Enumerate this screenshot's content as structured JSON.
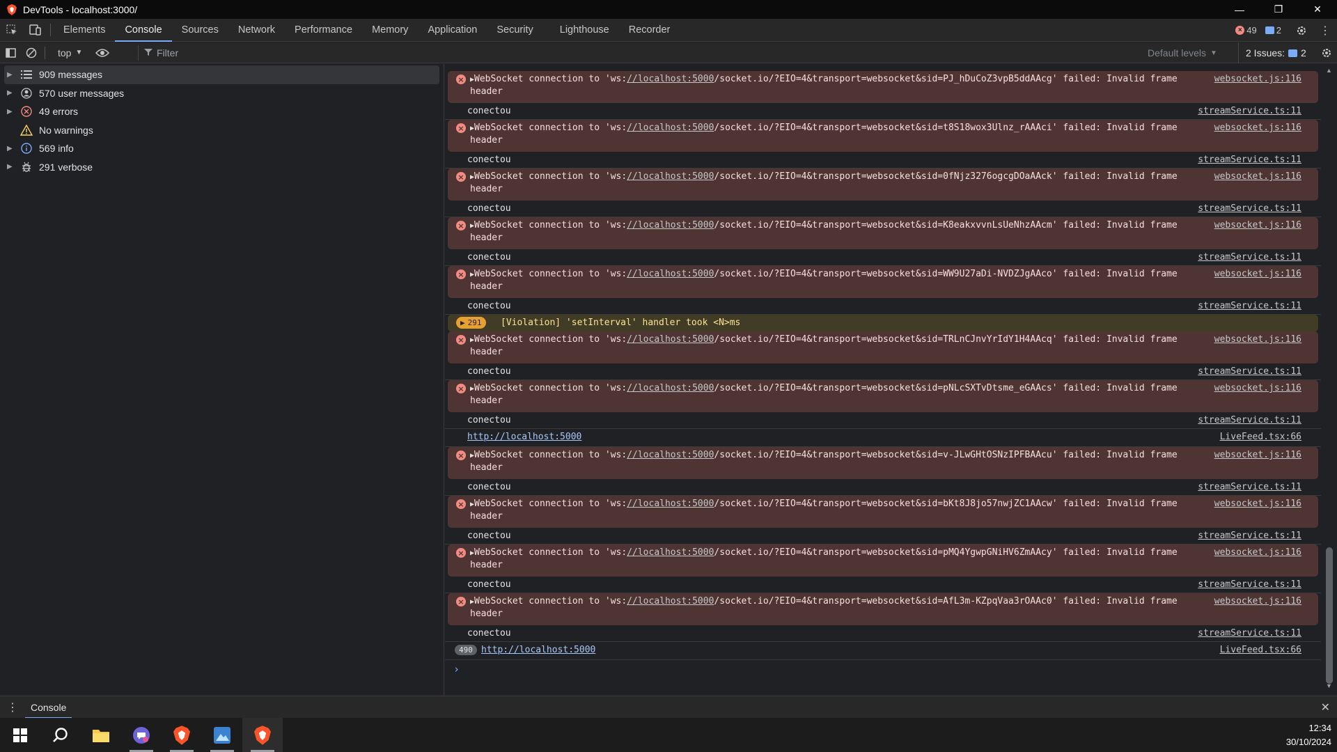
{
  "window": {
    "title": "DevTools - localhost:3000/"
  },
  "tabs": [
    {
      "label": "Elements"
    },
    {
      "label": "Console"
    },
    {
      "label": "Sources"
    },
    {
      "label": "Network"
    },
    {
      "label": "Performance"
    },
    {
      "label": "Memory"
    },
    {
      "label": "Application"
    },
    {
      "label": "Security"
    },
    {
      "label": "Lighthouse"
    },
    {
      "label": "Recorder"
    }
  ],
  "counts": {
    "errors": "49",
    "messages": "2"
  },
  "toolbar": {
    "context": "top",
    "filter_placeholder": "Filter",
    "levels": "Default levels",
    "issues_label": "2 Issues:",
    "issues_count": "2"
  },
  "sidebar": {
    "items": [
      {
        "label": "909 messages",
        "icon": "list-icon"
      },
      {
        "label": "570 user messages",
        "icon": "user-icon"
      },
      {
        "label": "49 errors",
        "icon": "error-icon"
      },
      {
        "label": "No warnings",
        "icon": "warning-icon"
      },
      {
        "label": "569 info",
        "icon": "info-icon"
      },
      {
        "label": "291 verbose",
        "icon": "bug-icon"
      }
    ]
  },
  "console": {
    "ws_prefix": "WebSocket connection to 'ws:",
    "ws_host": "//localhost:5000",
    "ws_failed": "' failed: Invalid frame",
    "ws_header": "header",
    "ws_src": "websocket.js:116",
    "log_text": "conectou",
    "log_src": "streamService.ts:11",
    "sids": [
      "/socket.io/?EIO=4&transport=websocket&sid=PJ_hDuCoZ3vpB5ddAAcg",
      "/socket.io/?EIO=4&transport=websocket&sid=t8S18wox3Ulnz_rAAAci",
      "/socket.io/?EIO=4&transport=websocket&sid=0fNjz3276ogcgDOaAAck",
      "/socket.io/?EIO=4&transport=websocket&sid=K8eakxvvnLsUeNhzAAcm",
      "/socket.io/?EIO=4&transport=websocket&sid=WW9U27aDi-NVDZJgAAco",
      "/socket.io/?EIO=4&transport=websocket&sid=TRLnCJnvYrIdY1H4AAcq",
      "/socket.io/?EIO=4&transport=websocket&sid=pNLcSXTvDtsme_eGAAcs",
      "/socket.io/?EIO=4&transport=websocket&sid=v-JLwGHtOSNzIPFBAAcu",
      "/socket.io/?EIO=4&transport=websocket&sid=bKt8J8jo57nwjZC1AAcw",
      "/socket.io/?EIO=4&transport=websocket&sid=pMQ4YgwpGNiHV6ZmAAcy",
      "/socket.io/?EIO=4&transport=websocket&sid=AfL3m-KZpqVaa3rOAAc0"
    ],
    "violation": {
      "count": "291",
      "text": "[Violation] 'setInterval' handler took <N>ms"
    },
    "link_row": {
      "text": "http://localhost:5000",
      "src": "LiveFeed.tsx:66"
    },
    "last_row": {
      "count": "490",
      "text": "http://localhost:5000",
      "src": "LiveFeed.tsx:66"
    }
  },
  "drawer": {
    "tab": "Console"
  },
  "taskbar": {
    "time": "12:34",
    "date": "30/10/2024"
  },
  "colors": {
    "accent": "#7cacf8",
    "error_bg": "#4e3534",
    "error_icon": "#f28b82",
    "violation_bg": "#413c26"
  }
}
